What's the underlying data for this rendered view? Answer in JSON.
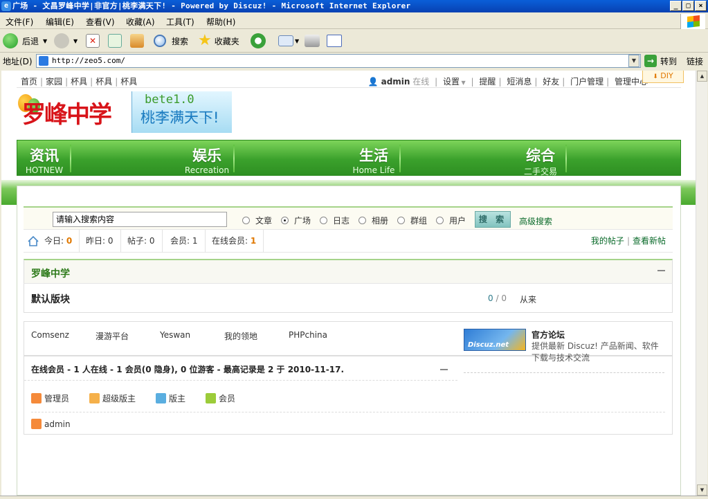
{
  "window": {
    "title": "广场 - 文昌罗峰中学|非官方|桃李满天下! - Powered by Discuz! - Microsoft Internet Explorer",
    "min": "_",
    "max": "□",
    "close": "×"
  },
  "menubar": [
    "文件(F)",
    "编辑(E)",
    "查看(V)",
    "收藏(A)",
    "工具(T)",
    "帮助(H)"
  ],
  "toolbar": {
    "back": "后退",
    "search": "搜索",
    "favorites": "收藏夹"
  },
  "address": {
    "label": "地址(D)",
    "url": "http://zeo5.com/",
    "go": "转到",
    "links": "链接"
  },
  "topnav": {
    "left": [
      "首页",
      "家园",
      "杯具",
      "杯具",
      "杯具"
    ],
    "user": "admin",
    "status": "在线",
    "right": [
      "设置",
      "提醒",
      "短消息",
      "好友",
      "门户管理",
      "管理中心"
    ],
    "diy": "DIY"
  },
  "logo": {
    "name": "罗峰中学",
    "banner_version": "bete1.0",
    "banner_slogan": "桃李满天下!"
  },
  "main_nav": [
    {
      "cn": "资讯",
      "en": "HOTNEW"
    },
    {
      "cn": "娱乐",
      "en": "Recreation"
    },
    {
      "cn": "生活",
      "en": "Home Life"
    },
    {
      "cn": "综合",
      "en": "二手交易"
    }
  ],
  "search": {
    "value": "请输入搜索内容",
    "options": [
      "文章",
      "广场",
      "日志",
      "相册",
      "群组",
      "用户"
    ],
    "selected": "广场",
    "button": "搜 索",
    "advanced": "高级搜索"
  },
  "stats": {
    "today_label": "今日:",
    "today": "0",
    "yesterday_label": "昨日:",
    "yesterday": "0",
    "posts_label": "帖子:",
    "posts": "0",
    "members_label": "会员:",
    "members": "1",
    "online_label": "在线会员:",
    "online": "1",
    "my_posts": "我的帖子",
    "new_posts": "查看新帖"
  },
  "forum": {
    "category": "罗峰中学",
    "board": "默认版块",
    "threads": "0",
    "posts": "0",
    "last": "从来"
  },
  "friend_links": [
    "Comsenz",
    "漫游平台",
    "Yeswan",
    "我的领地",
    "PHPchina"
  ],
  "official": {
    "logo_text": "Discuz.net",
    "title": "官方论坛",
    "desc": "提供最新 Discuz! 产品新闻、软件下载与技术交流"
  },
  "online_info": {
    "header": "在线会员 - 1 人在线 - 1 会员(0 隐身), 0 位游客 - 最高记录是 2 于 2010-11-17.",
    "groups": [
      {
        "label": "管理员",
        "color": "#f58a3a"
      },
      {
        "label": "超级版主",
        "color": "#f5b04a"
      },
      {
        "label": "版主",
        "color": "#5aaee0"
      },
      {
        "label": "会员",
        "color": "#9ccc3a"
      }
    ],
    "users": [
      "admin"
    ]
  }
}
